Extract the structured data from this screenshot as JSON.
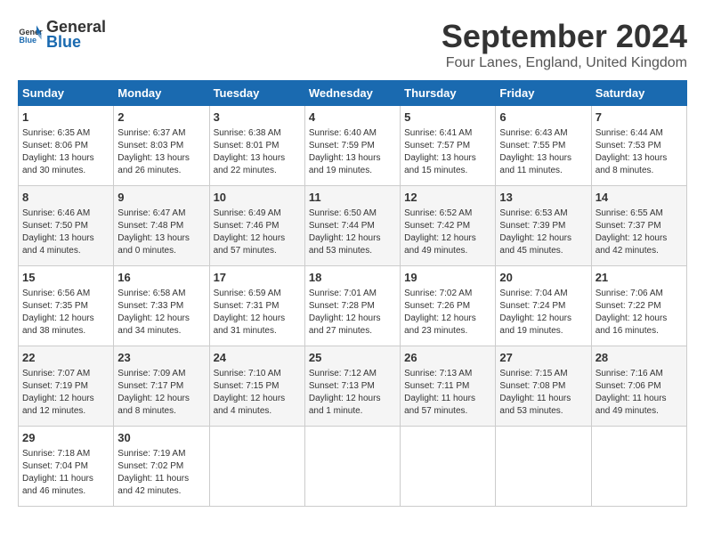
{
  "logo": {
    "general": "General",
    "blue": "Blue"
  },
  "title": "September 2024",
  "location": "Four Lanes, England, United Kingdom",
  "days_of_week": [
    "Sunday",
    "Monday",
    "Tuesday",
    "Wednesday",
    "Thursday",
    "Friday",
    "Saturday"
  ],
  "weeks": [
    [
      {
        "day": "1",
        "sunrise": "Sunrise: 6:35 AM",
        "sunset": "Sunset: 8:06 PM",
        "daylight": "Daylight: 13 hours and 30 minutes."
      },
      {
        "day": "2",
        "sunrise": "Sunrise: 6:37 AM",
        "sunset": "Sunset: 8:03 PM",
        "daylight": "Daylight: 13 hours and 26 minutes."
      },
      {
        "day": "3",
        "sunrise": "Sunrise: 6:38 AM",
        "sunset": "Sunset: 8:01 PM",
        "daylight": "Daylight: 13 hours and 22 minutes."
      },
      {
        "day": "4",
        "sunrise": "Sunrise: 6:40 AM",
        "sunset": "Sunset: 7:59 PM",
        "daylight": "Daylight: 13 hours and 19 minutes."
      },
      {
        "day": "5",
        "sunrise": "Sunrise: 6:41 AM",
        "sunset": "Sunset: 7:57 PM",
        "daylight": "Daylight: 13 hours and 15 minutes."
      },
      {
        "day": "6",
        "sunrise": "Sunrise: 6:43 AM",
        "sunset": "Sunset: 7:55 PM",
        "daylight": "Daylight: 13 hours and 11 minutes."
      },
      {
        "day": "7",
        "sunrise": "Sunrise: 6:44 AM",
        "sunset": "Sunset: 7:53 PM",
        "daylight": "Daylight: 13 hours and 8 minutes."
      }
    ],
    [
      {
        "day": "8",
        "sunrise": "Sunrise: 6:46 AM",
        "sunset": "Sunset: 7:50 PM",
        "daylight": "Daylight: 13 hours and 4 minutes."
      },
      {
        "day": "9",
        "sunrise": "Sunrise: 6:47 AM",
        "sunset": "Sunset: 7:48 PM",
        "daylight": "Daylight: 13 hours and 0 minutes."
      },
      {
        "day": "10",
        "sunrise": "Sunrise: 6:49 AM",
        "sunset": "Sunset: 7:46 PM",
        "daylight": "Daylight: 12 hours and 57 minutes."
      },
      {
        "day": "11",
        "sunrise": "Sunrise: 6:50 AM",
        "sunset": "Sunset: 7:44 PM",
        "daylight": "Daylight: 12 hours and 53 minutes."
      },
      {
        "day": "12",
        "sunrise": "Sunrise: 6:52 AM",
        "sunset": "Sunset: 7:42 PM",
        "daylight": "Daylight: 12 hours and 49 minutes."
      },
      {
        "day": "13",
        "sunrise": "Sunrise: 6:53 AM",
        "sunset": "Sunset: 7:39 PM",
        "daylight": "Daylight: 12 hours and 45 minutes."
      },
      {
        "day": "14",
        "sunrise": "Sunrise: 6:55 AM",
        "sunset": "Sunset: 7:37 PM",
        "daylight": "Daylight: 12 hours and 42 minutes."
      }
    ],
    [
      {
        "day": "15",
        "sunrise": "Sunrise: 6:56 AM",
        "sunset": "Sunset: 7:35 PM",
        "daylight": "Daylight: 12 hours and 38 minutes."
      },
      {
        "day": "16",
        "sunrise": "Sunrise: 6:58 AM",
        "sunset": "Sunset: 7:33 PM",
        "daylight": "Daylight: 12 hours and 34 minutes."
      },
      {
        "day": "17",
        "sunrise": "Sunrise: 6:59 AM",
        "sunset": "Sunset: 7:31 PM",
        "daylight": "Daylight: 12 hours and 31 minutes."
      },
      {
        "day": "18",
        "sunrise": "Sunrise: 7:01 AM",
        "sunset": "Sunset: 7:28 PM",
        "daylight": "Daylight: 12 hours and 27 minutes."
      },
      {
        "day": "19",
        "sunrise": "Sunrise: 7:02 AM",
        "sunset": "Sunset: 7:26 PM",
        "daylight": "Daylight: 12 hours and 23 minutes."
      },
      {
        "day": "20",
        "sunrise": "Sunrise: 7:04 AM",
        "sunset": "Sunset: 7:24 PM",
        "daylight": "Daylight: 12 hours and 19 minutes."
      },
      {
        "day": "21",
        "sunrise": "Sunrise: 7:06 AM",
        "sunset": "Sunset: 7:22 PM",
        "daylight": "Daylight: 12 hours and 16 minutes."
      }
    ],
    [
      {
        "day": "22",
        "sunrise": "Sunrise: 7:07 AM",
        "sunset": "Sunset: 7:19 PM",
        "daylight": "Daylight: 12 hours and 12 minutes."
      },
      {
        "day": "23",
        "sunrise": "Sunrise: 7:09 AM",
        "sunset": "Sunset: 7:17 PM",
        "daylight": "Daylight: 12 hours and 8 minutes."
      },
      {
        "day": "24",
        "sunrise": "Sunrise: 7:10 AM",
        "sunset": "Sunset: 7:15 PM",
        "daylight": "Daylight: 12 hours and 4 minutes."
      },
      {
        "day": "25",
        "sunrise": "Sunrise: 7:12 AM",
        "sunset": "Sunset: 7:13 PM",
        "daylight": "Daylight: 12 hours and 1 minute."
      },
      {
        "day": "26",
        "sunrise": "Sunrise: 7:13 AM",
        "sunset": "Sunset: 7:11 PM",
        "daylight": "Daylight: 11 hours and 57 minutes."
      },
      {
        "day": "27",
        "sunrise": "Sunrise: 7:15 AM",
        "sunset": "Sunset: 7:08 PM",
        "daylight": "Daylight: 11 hours and 53 minutes."
      },
      {
        "day": "28",
        "sunrise": "Sunrise: 7:16 AM",
        "sunset": "Sunset: 7:06 PM",
        "daylight": "Daylight: 11 hours and 49 minutes."
      }
    ],
    [
      {
        "day": "29",
        "sunrise": "Sunrise: 7:18 AM",
        "sunset": "Sunset: 7:04 PM",
        "daylight": "Daylight: 11 hours and 46 minutes."
      },
      {
        "day": "30",
        "sunrise": "Sunrise: 7:19 AM",
        "sunset": "Sunset: 7:02 PM",
        "daylight": "Daylight: 11 hours and 42 minutes."
      },
      null,
      null,
      null,
      null,
      null
    ]
  ]
}
